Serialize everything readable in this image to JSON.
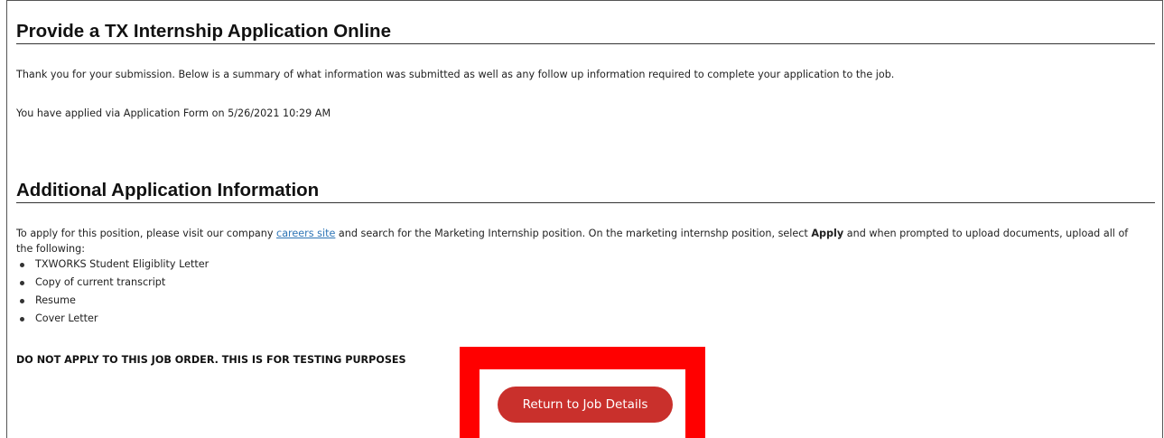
{
  "confirmation": {
    "title": "Provide a TX Internship Application Online",
    "thank_you": "Thank you for your submission. Below is a summary of what information was submitted as well as any follow up information required to complete your application to the job.",
    "applied_via": "You have applied via Application Form on 5/26/2021 10:29 AM"
  },
  "additional_info": {
    "title": "Additional Application Information",
    "instructions": {
      "before_link": "To apply for this position, please visit our company ",
      "link_text": "careers site",
      "after_link": " and search for the Marketing Internship position.  On the marketing internshp position, select ",
      "bold_word": "Apply",
      "after_bold": " and when prompted to upload documents, upload all of the following:"
    },
    "documents": [
      "TXWORKS Student Eligiblity Letter",
      "Copy of current transcript",
      "Resume",
      "Cover Letter"
    ],
    "warning": "DO NOT APPLY TO THIS JOB ORDER.  THIS IS FOR TESTING PURPOSES"
  },
  "actions": {
    "return_label": "Return to Job Details"
  },
  "colors": {
    "button": "#c9302c",
    "highlight": "#ff0000",
    "link": "#2e75b6"
  }
}
